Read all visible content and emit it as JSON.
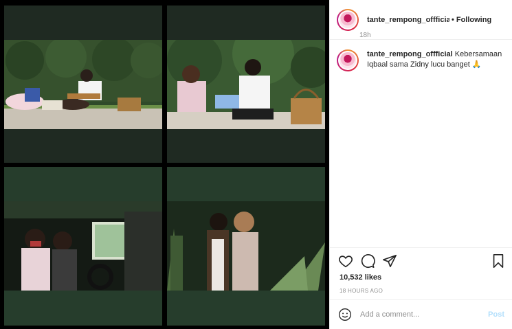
{
  "header": {
    "username": "tante_rempong_offficial",
    "dot": "•",
    "follow_status": "Following"
  },
  "caption": {
    "username": "tante_rempong_offficial",
    "text": "Kebersamaan Iqbaal sama Zidny lucu banget 🙏",
    "time": "18h"
  },
  "actions": {
    "icons": [
      "heart-icon",
      "comment-icon",
      "share-icon",
      "bookmark-icon"
    ],
    "likes": "10,532 likes",
    "post_time": "18 HOURS AGO"
  },
  "comment": {
    "placeholder": "Add a comment...",
    "post_label": "Post"
  },
  "colors": {
    "panel_bg": "#ffffff",
    "text": "#262626",
    "muted": "#8e8e8e",
    "post_disabled": "#b2dffc",
    "frame_dark_green": "#1f2a22",
    "frame_green": "#263d2c"
  }
}
